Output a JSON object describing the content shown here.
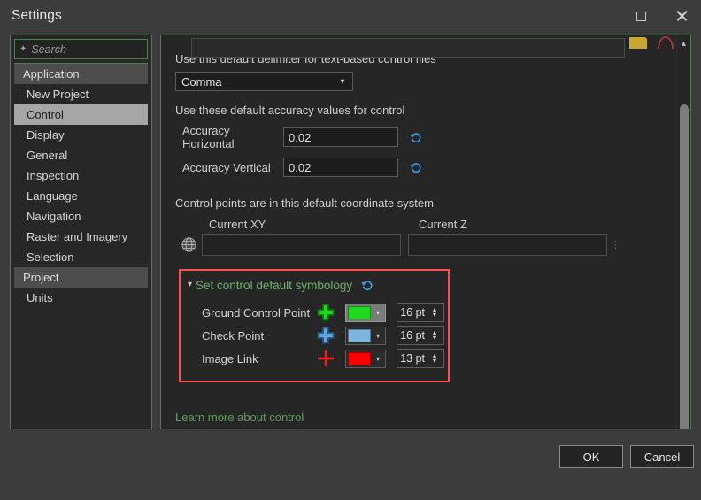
{
  "window": {
    "title": "Settings",
    "controls": {
      "maximize": "maximize-icon",
      "close": "close-icon"
    }
  },
  "sidebar": {
    "search": {
      "placeholder": "Search",
      "sparkle_icon": "sparkle-icon",
      "magnifier_icon": "search-icon",
      "chevron_icon": "chevron-down-icon"
    },
    "groups": [
      {
        "label": "Application",
        "items": [
          {
            "label": "New Project",
            "selected": false
          },
          {
            "label": "Control",
            "selected": true
          },
          {
            "label": "Display",
            "selected": false
          },
          {
            "label": "General",
            "selected": false
          },
          {
            "label": "Inspection",
            "selected": false
          },
          {
            "label": "Language",
            "selected": false
          },
          {
            "label": "Navigation",
            "selected": false
          },
          {
            "label": "Raster and Imagery",
            "selected": false
          },
          {
            "label": "Selection",
            "selected": false
          }
        ]
      },
      {
        "label": "Project",
        "items": [
          {
            "label": "Units",
            "selected": false
          }
        ]
      }
    ]
  },
  "main": {
    "delimiter": {
      "label": "Use this default delimiter for text-based control files",
      "value": "Comma",
      "chevron": "⌄"
    },
    "accuracy": {
      "label": "Use these default accuracy values for control",
      "rows": [
        {
          "label": "Accuracy Horizontal",
          "value": "0.02",
          "reset_icon": "reset-icon"
        },
        {
          "label": "Accuracy Vertical",
          "value": "0.02",
          "reset_icon": "reset-icon"
        }
      ]
    },
    "coordinate_system": {
      "label": "Control points are in this default coordinate system",
      "globe_icon": "globe-icon",
      "columns": [
        {
          "header": "Current XY",
          "value": ""
        },
        {
          "header": "Current Z",
          "value": ""
        }
      ]
    },
    "symbology": {
      "title": "Set control default symbology",
      "collapse_icon": "chevron-down-icon",
      "reset_icon": "reset-icon",
      "highlight_color": "#fa5050",
      "title_color": "#6fae6f",
      "rows": [
        {
          "label": "Ground Control Point",
          "marker": "plus-marker-icon",
          "marker_fill": "#21d821",
          "marker_outline": "#0f7a0f",
          "marker_style": "thick",
          "color": "#21d821",
          "swatch_highlighted": true,
          "size": "16 pt"
        },
        {
          "label": "Check Point",
          "marker": "plus-marker-icon",
          "marker_fill": "#63a6dd",
          "marker_outline": "#2a5f92",
          "marker_style": "thick",
          "color": "#7fb4dd",
          "swatch_highlighted": false,
          "size": "16 pt"
        },
        {
          "label": "Image Link",
          "marker": "cross-marker-icon",
          "marker_fill": "#ff1a1a",
          "marker_outline": "#ff1a1a",
          "marker_style": "thin",
          "color": "#fa0000",
          "swatch_highlighted": false,
          "size": "13 pt"
        }
      ]
    },
    "learn_more": "Learn more about control",
    "scrollbar": {
      "up_icon": "chevron-up-icon",
      "down_icon": "chevron-down-icon"
    }
  },
  "footer": {
    "ok_label": "OK",
    "cancel_label": "Cancel"
  }
}
